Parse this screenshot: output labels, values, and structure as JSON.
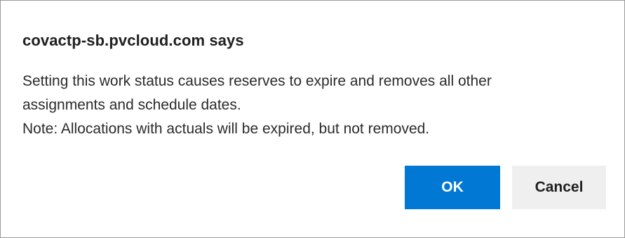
{
  "dialog": {
    "title": "covactp-sb.pvcloud.com says",
    "message_lines": [
      "Setting this work status causes reserves to expire and removes all other",
      "assignments and schedule dates.",
      "Note: Allocations with actuals will be expired, but not removed."
    ],
    "buttons": {
      "ok_label": "OK",
      "cancel_label": "Cancel"
    }
  },
  "colors": {
    "primary_button": "#0078d4",
    "secondary_button": "#efefef",
    "text": "#202020",
    "background": "#ffffff"
  }
}
